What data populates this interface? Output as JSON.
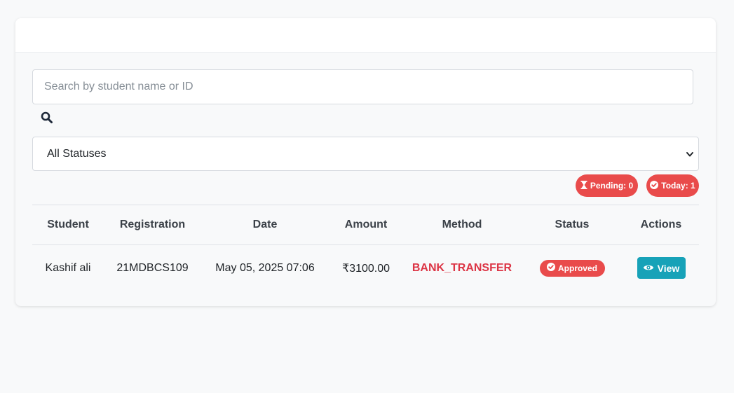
{
  "search": {
    "placeholder": "Search by student name or ID",
    "value": ""
  },
  "filter": {
    "selected": "All Statuses"
  },
  "badges": {
    "pending": "Pending: 0",
    "today": "Today: 1"
  },
  "table": {
    "headers": [
      "Student",
      "Registration",
      "Date",
      "Amount",
      "Method",
      "Status",
      "Actions"
    ],
    "rows": [
      {
        "student": "Kashif ali",
        "registration": "21MDBCS109",
        "date": "May 05, 2025 07:06",
        "amount": "₹3100.00",
        "method": "BANK_TRANSFER",
        "status": "Approved",
        "action": "View"
      }
    ]
  },
  "colors": {
    "danger": "#e94b4b",
    "info": "#17a2b8",
    "method": "#dc3545"
  },
  "icons": [
    "search-icon",
    "chevron-down-icon",
    "hourglass-icon",
    "check-circle-icon",
    "eye-icon"
  ]
}
